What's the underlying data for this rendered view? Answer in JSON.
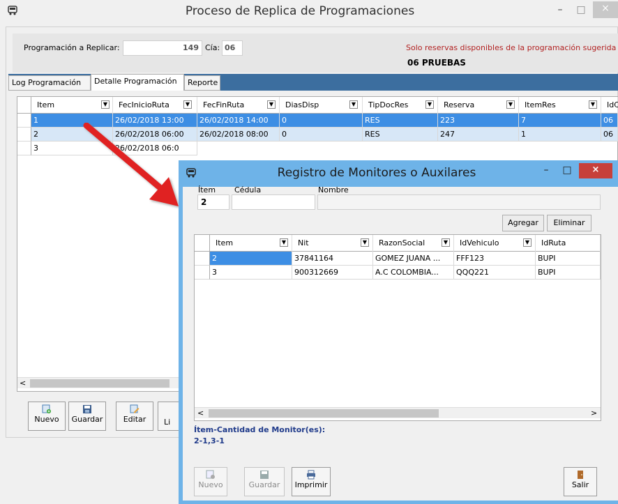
{
  "main": {
    "title": "Proceso de Replica de Programaciones",
    "minimize": "–",
    "maximize": "□",
    "close": "×",
    "prog_label": "Programación a Replicar:",
    "prog_value": "149",
    "cia_label": "Cía:",
    "cia_value": "06",
    "note": "Solo reservas disponibles de la programación sugerida",
    "company": "06 PRUEBAS",
    "tabs": [
      "Log Programación",
      "Detalle Programación",
      "Reporte"
    ],
    "active_tab": 1,
    "grid": {
      "columns": [
        "Item",
        "FecInicioRuta",
        "FecFinRuta",
        "DiasDisp",
        "TipDocRes",
        "Reserva",
        "ItemRes",
        "IdC"
      ],
      "rows": [
        [
          "1",
          "26/02/2018 13:00",
          "26/02/2018 14:00",
          "0",
          "RES",
          "223",
          "7",
          "06"
        ],
        [
          "2",
          "26/02/2018 06:00",
          "26/02/2018 08:00",
          "0",
          "RES",
          "247",
          "1",
          "06"
        ],
        [
          "3",
          "26/02/2018 06:0",
          "",
          "",
          "",
          "",
          "",
          ""
        ]
      ]
    },
    "toolbar": {
      "nuevo": "Nuevo",
      "guardar": "Guardar",
      "editar": "Editar",
      "limpiar": "Li"
    }
  },
  "popup": {
    "title": "Registro de Monitores o Auxilares",
    "item_label": "Ítem",
    "item_value": "2",
    "cedula_label": "Cédula",
    "cedula_value": "",
    "nombre_label": "Nombre",
    "nombre_value": "",
    "agregar": "Agregar",
    "eliminar": "Eliminar",
    "grid": {
      "columns": [
        "Item",
        "Nit",
        "RazonSocial",
        "IdVehiculo",
        "IdRuta"
      ],
      "rows": [
        [
          "2",
          "37841164",
          "GOMEZ JUANA ...",
          "FFF123",
          "BUPI"
        ],
        [
          "3",
          "900312669",
          "A.C COLOMBIA...",
          "QQQ221",
          "BUPI"
        ]
      ]
    },
    "summary_label": "Ítem-Cantidad de Monitor(es):",
    "summary_value": "2-1,3-1",
    "nuevo": "Nuevo",
    "guardar": "Guardar",
    "imprimir": "Imprimir",
    "salir": "Salir"
  },
  "colors": {
    "accent": "#3d8ee4",
    "tab_strip": "#3c6e9f",
    "popup_frame": "#6eb3e8",
    "note_red": "#b22222",
    "summary_blue": "#1f3a8a",
    "arrow_red": "#e02020"
  }
}
